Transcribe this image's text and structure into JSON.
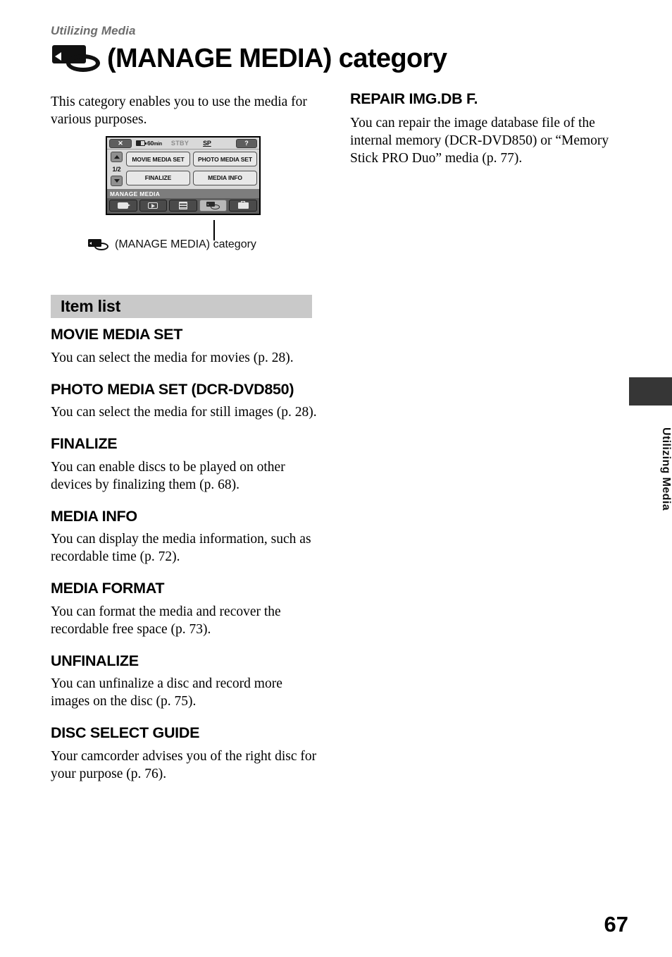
{
  "running_head": "Utilizing Media",
  "title": {
    "icon": "manage-media-icon",
    "text": "(MANAGE MEDIA) category"
  },
  "intro_paragraph": "This category enables you to use the media for various purposes.",
  "lcd_figure": {
    "status_bar": {
      "close_label": "✕",
      "battery_time": "60",
      "battery_unit": "min",
      "mode": "STBY",
      "quality": "SP",
      "help_label": "?"
    },
    "page_indicator": "1/2",
    "up_arrow": "▲",
    "down_arrow": "▼",
    "menu_items": [
      "MOVIE MEDIA SET",
      "PHOTO MEDIA SET",
      "FINALIZE",
      "MEDIA INFO"
    ],
    "category_label": "MANAGE MEDIA",
    "tabs": [
      {
        "name": "camera-tab",
        "selected": false
      },
      {
        "name": "playback-tab",
        "selected": false
      },
      {
        "name": "menu-tab",
        "selected": false
      },
      {
        "name": "manage-media-tab",
        "selected": true
      },
      {
        "name": "others-tab",
        "selected": false
      }
    ]
  },
  "figure_caption": "(MANAGE MEDIA) category",
  "item_list": {
    "heading": "Item list",
    "entries": [
      {
        "title": "MOVIE MEDIA SET",
        "desc": "You can select the media for movies (p. 28)."
      },
      {
        "title": "PHOTO MEDIA SET (DCR-DVD850)",
        "desc": "You can select the media for still images (p. 28)."
      },
      {
        "title": "FINALIZE",
        "desc": "You can enable discs to be played on other devices by finalizing them (p. 68)."
      },
      {
        "title": "MEDIA INFO",
        "desc": "You can display the media information, such as recordable time (p. 72)."
      },
      {
        "title": "MEDIA FORMAT",
        "desc": "You can format the media and recover the recordable free space (p. 73)."
      },
      {
        "title": "UNFINALIZE",
        "desc": "You can unfinalize a disc and record more images on the disc (p. 75)."
      },
      {
        "title": "DISC SELECT GUIDE",
        "desc": "Your camcorder advises you of the right disc for your purpose (p. 76)."
      }
    ]
  },
  "right_column": {
    "title": "REPAIR IMG.DB F.",
    "desc": "You can repair the image database file of the internal memory (DCR-DVD850) or “Memory Stick PRO Duo” media (p. 77)."
  },
  "thumb_index": {
    "label": "Utilizing Media",
    "tab_color": "#363636"
  },
  "page_number": "67",
  "colors": {
    "section_bar": "#c9c9c9",
    "running_head": "#6d6d6d",
    "lcd_background": "#d9d9d9",
    "lcd_tabbar": "#5d5d5d"
  }
}
